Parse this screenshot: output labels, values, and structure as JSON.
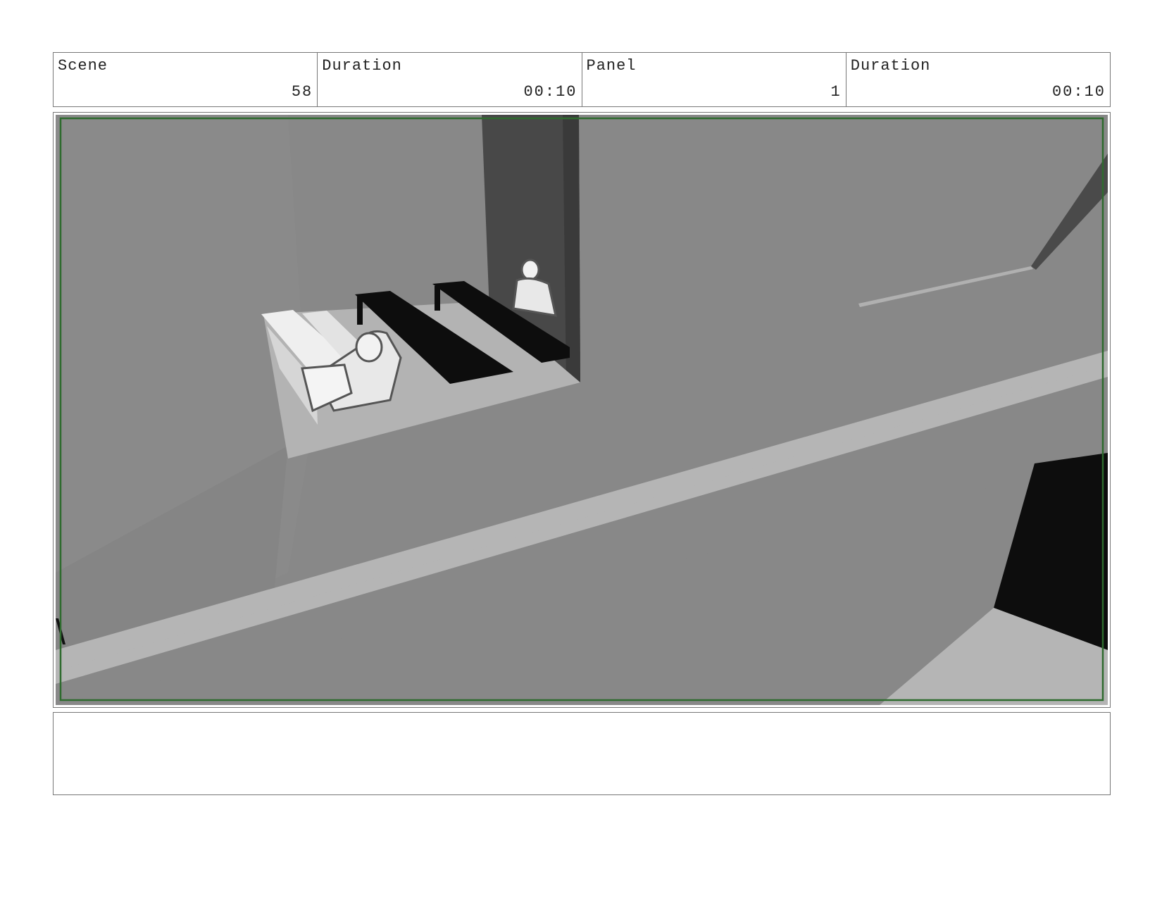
{
  "header": {
    "scene_label": "Scene",
    "scene_value": "58",
    "scene_duration_label": "Duration",
    "scene_duration_value": "00:10",
    "panel_label": "Panel",
    "panel_value": "1",
    "panel_duration_label": "Duration",
    "panel_duration_value": "00:10"
  },
  "notes": {
    "text": ""
  },
  "colors": {
    "safe_frame": "#2e6b2e",
    "wall": "#888888",
    "ledge": "#b5b5b5",
    "shadow": "#0d0d0d"
  }
}
